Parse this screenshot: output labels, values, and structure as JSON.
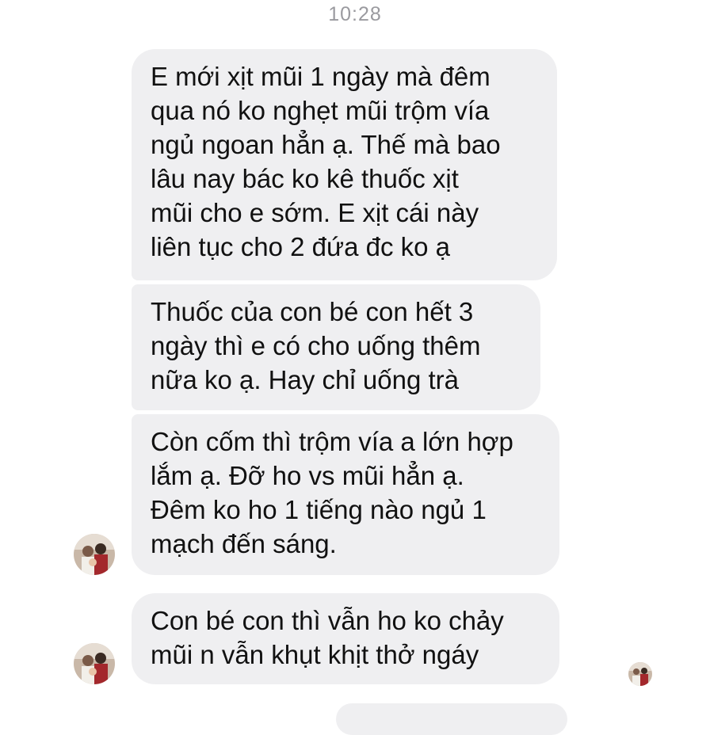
{
  "status": {
    "time": "10:28"
  },
  "messages": [
    {
      "text": "E mới xịt mũi 1 ngày mà đêm\nqua nó ko nghẹt mũi trộm vía\nngủ ngoan hẳn ạ. Thế mà bao\nlâu nay bác ko kê thuốc xịt\nmũi cho e sớm. E xịt cái này\nliên tục cho 2 đứa đc ko ạ"
    },
    {
      "text": "Thuốc của con bé con hết 3\nngày thì e có cho uống thêm\nnữa ko ạ. Hay chỉ uống trà"
    },
    {
      "text": "Còn cốm thì trộm vía a lớn hợp\nlắm ạ. Đỡ ho vs mũi hẳn ạ.\nĐêm ko ho 1 tiếng nào ngủ 1\nmạch đến sáng."
    },
    {
      "text": "Con bé con thì vẫn ho ko chảy\nmũi n vẫn khụt khịt thở ngáy"
    }
  ],
  "colors": {
    "bubble_background": "#efeff1",
    "message_text": "#111111",
    "timestamp_text": "#9a9a9f",
    "page_background": "#ffffff"
  },
  "icons": {
    "sender_avatar": "avatar-photo",
    "read_receipt": "read-receipt-avatar"
  }
}
